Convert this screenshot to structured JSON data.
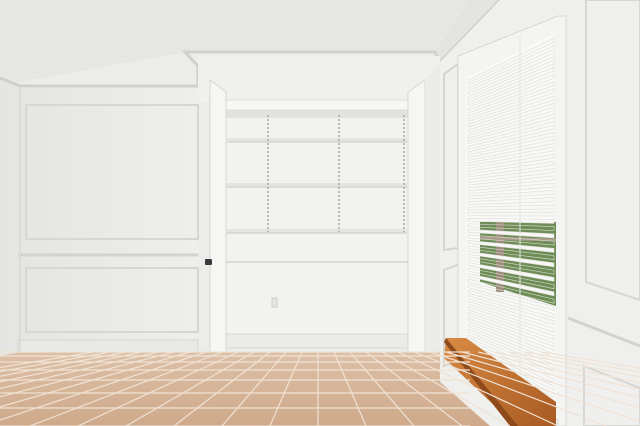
{
  "scene": {
    "subject": "",
    "colors": {
      "ceiling": "#e6e6e3",
      "wall": "#efefed",
      "wall_shadow": "#dededb",
      "molding": "#d3d3d0",
      "closet_interior": "#f3f3f1",
      "shelf": "#e4e4e1",
      "door": "#f6f6f4",
      "floor_tile": "#d7b79c",
      "floor_grout": "#f0e2d4",
      "window_bench": "#c4732f",
      "blind": "#f7f7f5",
      "foliage": "#6d8d55",
      "pergola": "#9a8c78"
    },
    "shelf_count": 3,
    "blind_slat_count": 52
  }
}
